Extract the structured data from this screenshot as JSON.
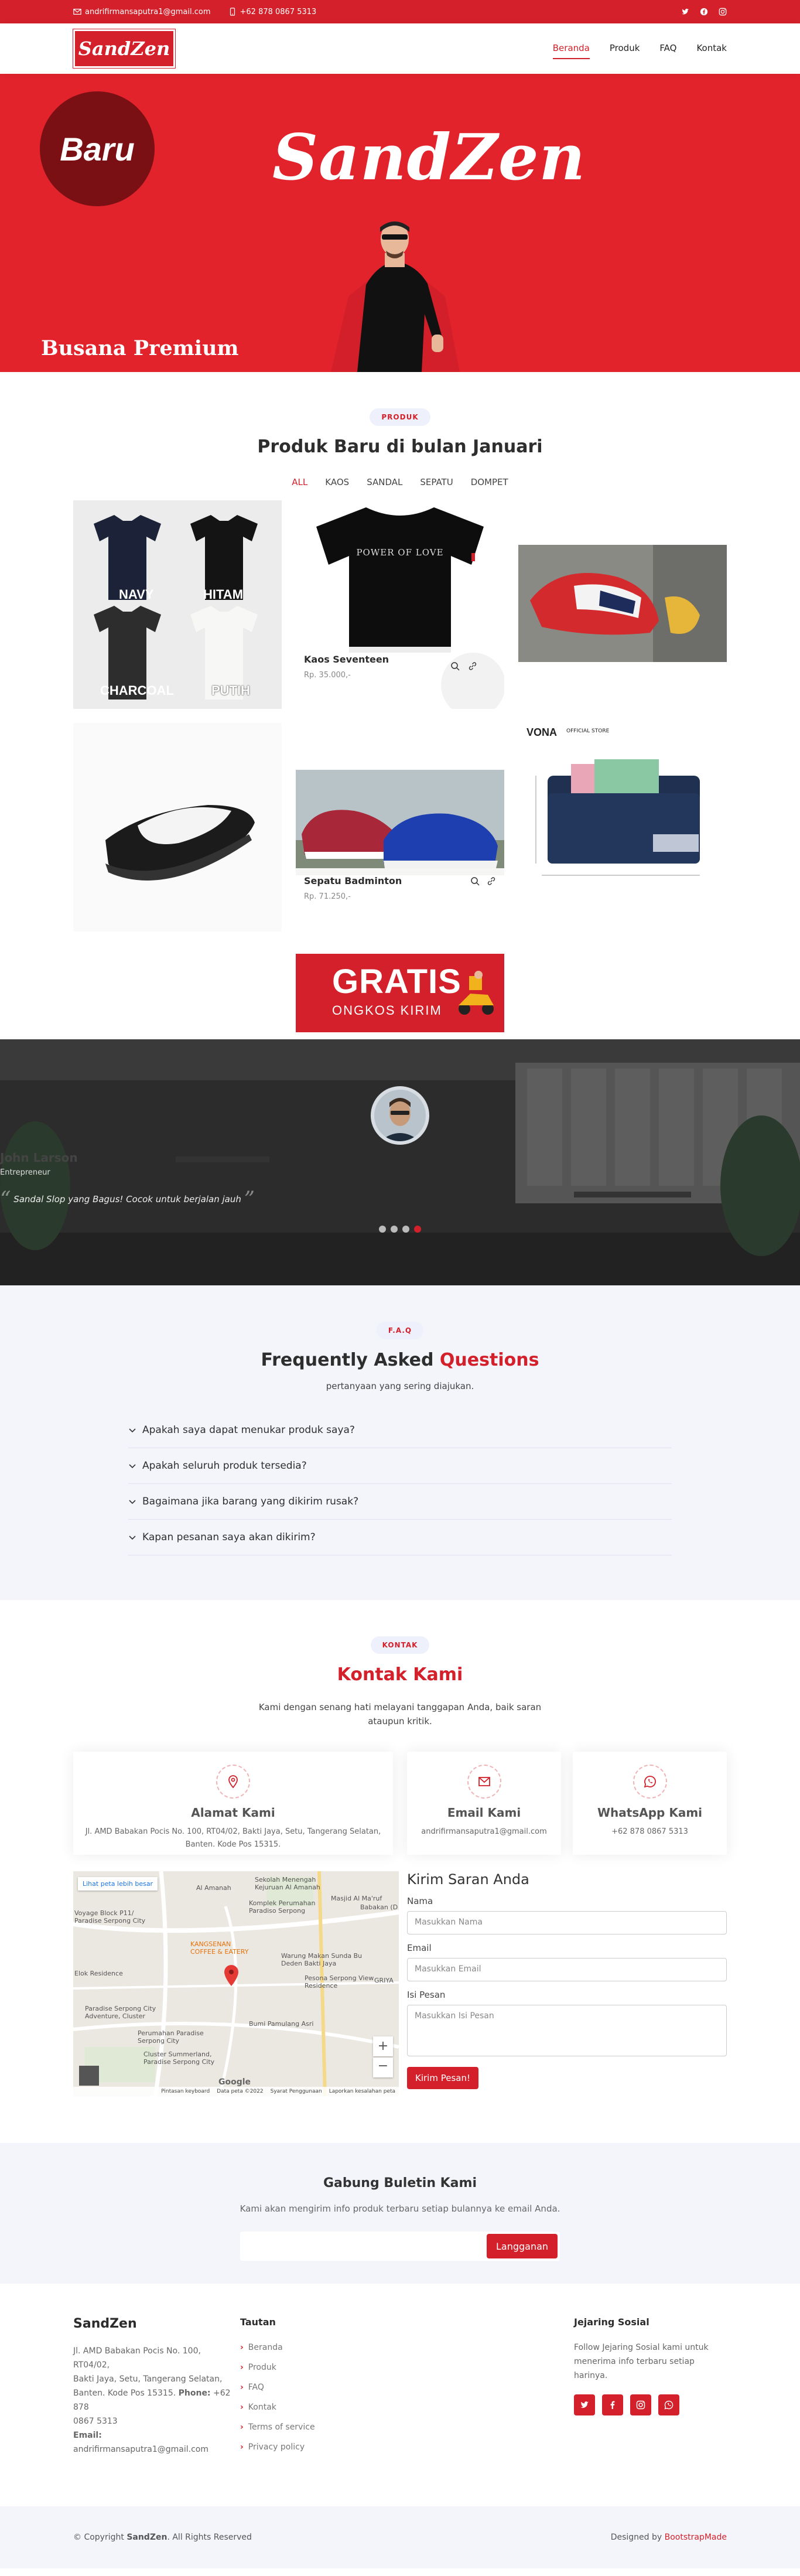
{
  "topbar": {
    "email": "andrifirmansaputra1@gmail.com",
    "phone": "+62 878 0867 5313",
    "social": [
      "twitter-icon",
      "facebook-icon",
      "instagram-icon"
    ]
  },
  "header": {
    "logo": "SandZen",
    "nav": [
      "Beranda",
      "Produk",
      "FAQ",
      "Kontak"
    ],
    "active": "Beranda"
  },
  "hero": {
    "badge": "Baru",
    "brand": "SandZen",
    "tagline": "Busana Premium"
  },
  "products": {
    "pill": "PRODUK",
    "title": "Produk Baru di bulan Januari",
    "filters": [
      "ALL",
      "KAOS",
      "SANDAL",
      "SEPATU",
      "DOMPET"
    ],
    "active_filter": "ALL",
    "tshirt_labels": [
      "NAVY",
      "HITAM",
      "CHARCOAL",
      "PUTIH"
    ],
    "shirt_print": "POWER OF LOVE",
    "item1": {
      "name": "Kaos Seventeen",
      "price": "Rp. 35.000,-"
    },
    "item2": {
      "name": "Sepatu Badminton",
      "price": "Rp. 71.250,-"
    },
    "wallet_brand": "VONA",
    "wallet_store": "OFFICIAL STORE",
    "banner_big": "GRATIS",
    "banner_small": "ONGKOS KIRIM"
  },
  "testimonial": {
    "name": "John Larson",
    "role": "Entrepreneur",
    "quote": "Sandal Slop yang Bagus! Cocok untuk berjalan jauh",
    "slides": 4,
    "active_slide": 4
  },
  "faq": {
    "pill": "F.A.Q",
    "title_a": "Frequently Asked",
    "title_b": "Questions",
    "subtitle": "pertanyaan yang sering diajukan.",
    "items": [
      "Apakah saya dapat menukar produk saya?",
      "Apakah seluruh produk tersedia?",
      "Bagaimana jika barang yang dikirim rusak?",
      "Kapan pesanan saya akan dikirim?"
    ]
  },
  "contact": {
    "pill": "KONTAK",
    "title": "Kontak Kami",
    "subtitle_1": "Kami dengan senang hati melayani tanggapan Anda, baik saran",
    "subtitle_2": "ataupun kritik.",
    "address_title": "Alamat Kami",
    "address_1": "Jl. AMD Babakan Pocis No. 100, RT04/02, Bakti Jaya, Setu, Tangerang Selatan,",
    "address_2": "Banten. Kode Pos 15315.",
    "email_title": "Email Kami",
    "email": "andrifirmansaputra1@gmail.com",
    "wa_title": "WhatsApp Kami",
    "wa": "+62 878 0867 5313",
    "map": {
      "link": "Lihat peta lebih besar",
      "places": [
        "Sekolah Menengah Kejuruan Al Amanah",
        "Al Amanah",
        "Masjid Al Ma'ruf",
        "Babakan (D",
        "Komplek Perumahan Paradiso Serpong",
        "Voyage Block P11/ Paradise Serpong City",
        "KANGSENAN COFFEE & EATERY",
        "Warung Makan Sunda Bu Deden Bakti Jaya",
        "Elok Residence",
        "Pesona Serpong View Residence",
        "GRIYA",
        "Paradise Serpong City Adventure, Cluster",
        "Bumi Pamulang Asri",
        "Perumahan Paradise Serpong City",
        "Cluster Summerland, Paradise Serpong City",
        "Google"
      ],
      "footer": [
        "Pintasan keyboard",
        "Data peta ©2022",
        "Syarat Penggunaan",
        "Laporkan kesalahan peta"
      ]
    },
    "form": {
      "title": "Kirim Saran Anda",
      "name_label": "Nama",
      "name_ph": "Masukkan Nama",
      "email_label": "Email",
      "email_ph": "Masukkan Email",
      "msg_label": "Isi Pesan",
      "msg_ph": "Masukkan Isi Pesan",
      "submit": "Kirim Pesan!"
    }
  },
  "newsletter": {
    "title": "Gabung Buletin Kami",
    "text": "Kami akan mengirim info produk terbaru setiap bulannya ke email Anda.",
    "button": "Langganan"
  },
  "footer": {
    "brand": "SandZen",
    "address_1": "Jl. AMD Babakan Pocis No. 100, RT04/02,",
    "address_2": "Bakti Jaya, Setu, Tangerang Selatan,",
    "address_3": "Banten. Kode Pos 15315.",
    "phone_label": "Phone:",
    "phone": "+62 878",
    "phone_2": "0867 5313",
    "email_label": "Email:",
    "email": "andrifirmansaputra1@gmail.com",
    "links_title": "Tautan",
    "links": [
      "Beranda",
      "Produk",
      "FAQ",
      "Kontak",
      "Terms of service",
      "Privacy policy"
    ],
    "social_title": "Jejaring Sosial",
    "social_text_1": "Follow Jejaring Sosial kami untuk",
    "social_text_2": "menerima info terbaru setiap harinya.",
    "social": [
      "twitter-icon",
      "facebook-icon",
      "instagram-icon",
      "whatsapp-icon"
    ]
  },
  "bottom": {
    "copy_a": "© Copyright",
    "copy_brand": "SandZen",
    "copy_b": ". All Rights Reserved",
    "design_a": "Designed by",
    "design_b": "BootstrapMade"
  },
  "colors": {
    "accent": "#d3202a",
    "dark": "#2b2b2b",
    "light": "#f3f5fb"
  }
}
